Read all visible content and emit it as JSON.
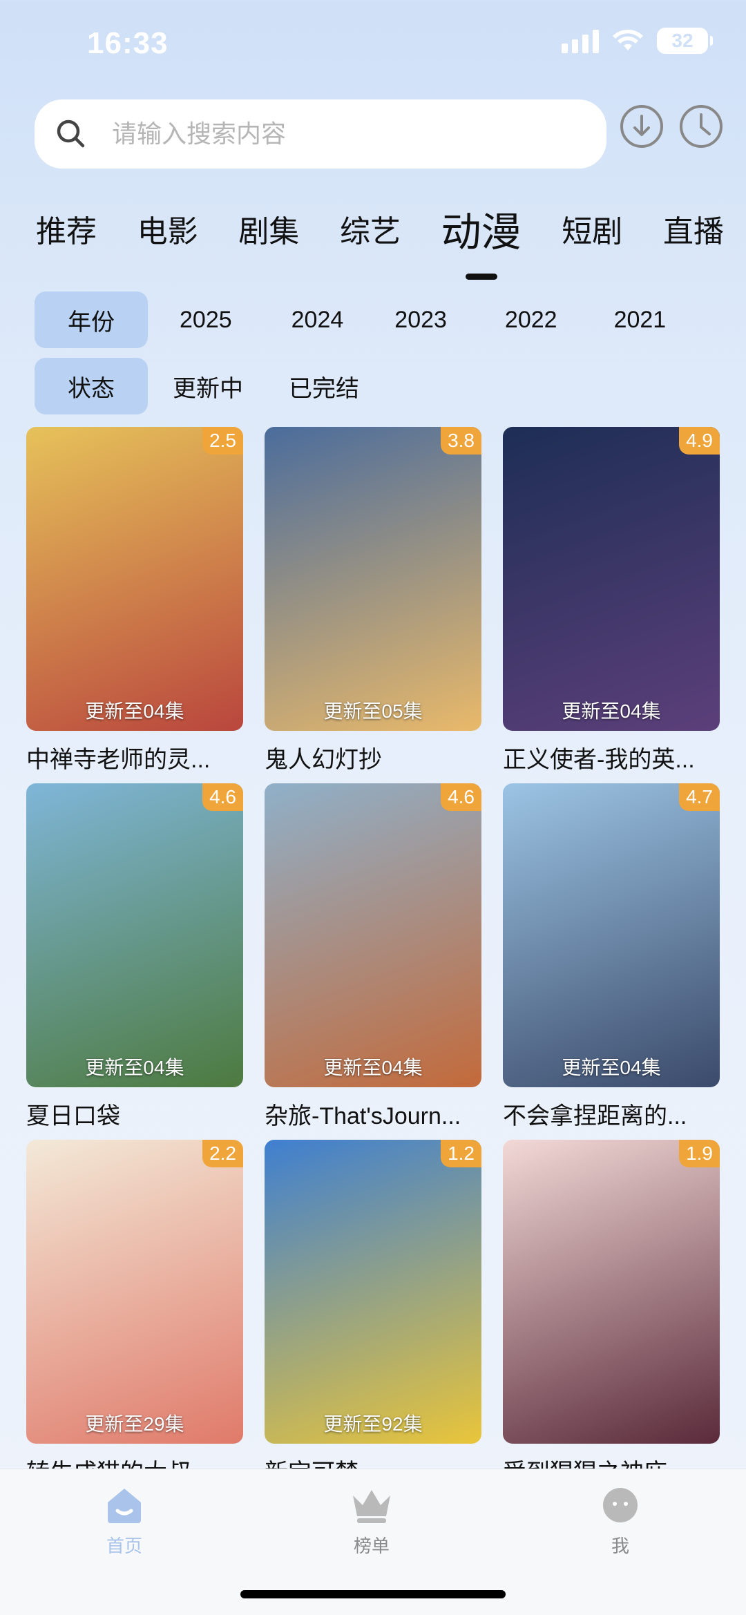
{
  "status": {
    "time": "16:33",
    "battery": "32"
  },
  "search": {
    "placeholder": "请输入搜索内容"
  },
  "header_icons": {
    "download": "download-circle-icon",
    "history": "clock-icon"
  },
  "tabs": [
    {
      "label": "推荐"
    },
    {
      "label": "电影"
    },
    {
      "label": "剧集"
    },
    {
      "label": "综艺"
    },
    {
      "label": "动漫"
    },
    {
      "label": "短剧"
    },
    {
      "label": "直播"
    }
  ],
  "active_tab": "动漫",
  "filters": {
    "year": {
      "label": "年份",
      "options": [
        "2025",
        "2024",
        "2023",
        "2022",
        "2021"
      ]
    },
    "status": {
      "label": "状态",
      "options": [
        "更新中",
        "已完结"
      ]
    }
  },
  "items": [
    {
      "title": "中禅寺老师的灵...",
      "score": "2.5",
      "update": "更新至04集",
      "colors": [
        "#e6c25a",
        "#b9463d"
      ]
    },
    {
      "title": "鬼人幻灯抄",
      "score": "3.8",
      "update": "更新至05集",
      "colors": [
        "#4a6c9c",
        "#e9b96a"
      ]
    },
    {
      "title": "正义使者-我的英...",
      "score": "4.9",
      "update": "更新至04集",
      "colors": [
        "#1d2e55",
        "#5c3f7a"
      ]
    },
    {
      "title": "夏日口袋",
      "score": "4.6",
      "update": "更新至04集",
      "colors": [
        "#7fb6d8",
        "#4d7a3f"
      ]
    },
    {
      "title": "杂旅-That'sJourn...",
      "score": "4.6",
      "update": "更新至04集",
      "colors": [
        "#8fb0c9",
        "#c36a3a"
      ]
    },
    {
      "title": "不会拿捏距离的...",
      "score": "4.7",
      "update": "更新至04集",
      "colors": [
        "#9cc4e4",
        "#3b4a6a"
      ]
    },
    {
      "title": "转生成猫的大叔",
      "score": "2.2",
      "update": "更新至29集",
      "colors": [
        "#f3e9d8",
        "#e07a6a"
      ]
    },
    {
      "title": "新宝可梦",
      "score": "1.2",
      "update": "更新至92集",
      "colors": [
        "#3e7fd1",
        "#e9c53a"
      ]
    },
    {
      "title": "受到猩猩之神庇...",
      "score": "1.9",
      "update": "",
      "colors": [
        "#f2d9d6",
        "#5a2a3a"
      ]
    }
  ],
  "bottom_nav": [
    {
      "label": "首页",
      "icon": "home-icon",
      "active": true
    },
    {
      "label": "榜单",
      "icon": "crown-icon",
      "active": false
    },
    {
      "label": "我",
      "icon": "profile-icon",
      "active": false
    }
  ],
  "colors": {
    "accent": "#b9d2f3",
    "score_badge": "#f0a53a",
    "nav_active": "#a9c3ea",
    "nav_inactive": "#9a9a9a"
  }
}
